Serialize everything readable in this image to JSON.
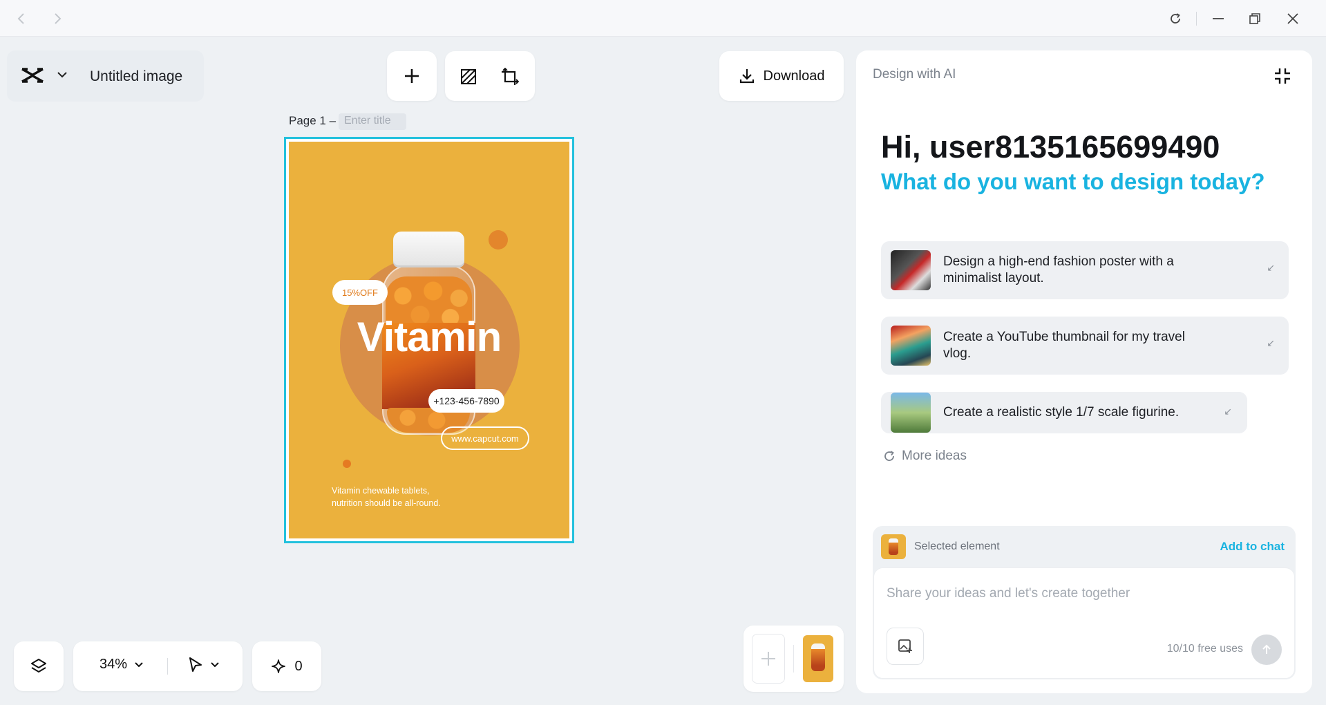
{
  "window": {
    "back_icon": "chevron-left-icon",
    "forward_icon": "chevron-right-icon",
    "controls": [
      "refresh-icon",
      "minimize-icon",
      "restore-icon",
      "close-icon"
    ]
  },
  "app": {
    "logo": "capcut-logo",
    "document_title": "Untitled image"
  },
  "toolbar": {
    "add_icon": "plus-icon",
    "background_icon": "background-icon",
    "resize_icon": "resize-icon",
    "download_label": "Download"
  },
  "page": {
    "label": "Page 1 –",
    "title_placeholder": "Enter title"
  },
  "poster": {
    "background_color": "#ebb13d",
    "badge": "15%OFF",
    "headline": "Vitamin",
    "phone": "+123-456-7890",
    "website": "www.capcut.com",
    "tagline_line1": "Vitamin chewable tablets,",
    "tagline_line2": "nutrition should be all-round."
  },
  "bottom_bar": {
    "layers_icon": "layers-icon",
    "zoom": "34%",
    "pointer_icon": "pointer-icon",
    "ai_credits_icon": "sparkle-icon",
    "ai_credits": "0"
  },
  "ai_panel": {
    "header": "Design with AI",
    "collapse_icon": "collapse-icon",
    "greeting": "Hi, user8135165699490",
    "question": "What do you want to design today?",
    "ideas": [
      {
        "line1": "Design a high-end fashion poster with a",
        "line2": "minimalist layout."
      },
      {
        "line1": "Create a YouTube thumbnail for my travel",
        "line2": "vlog."
      },
      {
        "line1": "Create a realistic style 1/7 scale figurine.",
        "line2": ""
      }
    ],
    "more_ideas": "More ideas",
    "selected_element_label": "Selected element",
    "add_to_chat": "Add to chat",
    "input_placeholder": "Share your ideas and let's create together",
    "free_uses": "10/10 free uses"
  },
  "colors": {
    "accent": "#19b3e0",
    "selection": "#23c1dd"
  }
}
